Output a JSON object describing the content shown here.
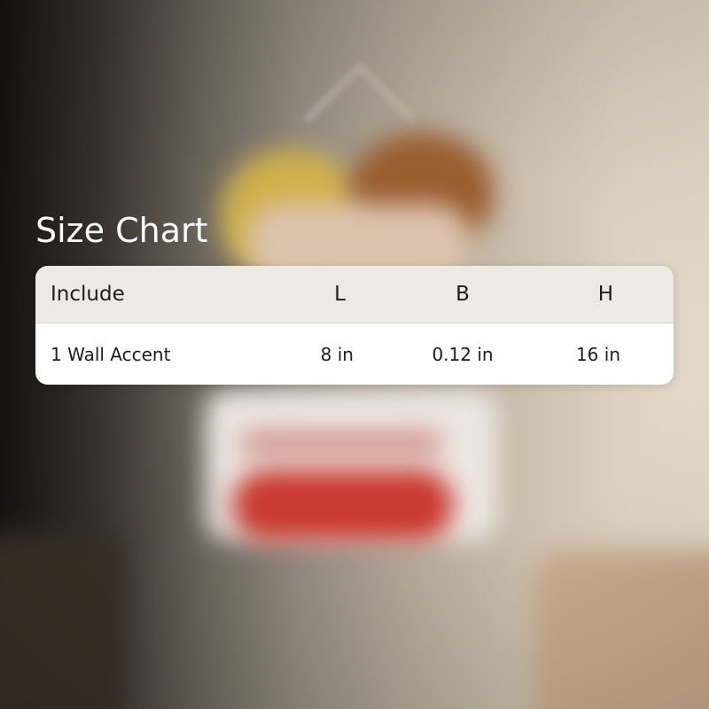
{
  "size_chart": {
    "title": "Size Chart",
    "columns": [
      "Include",
      "L",
      "B",
      "H"
    ],
    "rows": [
      [
        "1 Wall Accent",
        "8 in",
        "0.12 in",
        "16 in"
      ]
    ]
  },
  "colors": {
    "header_bg": "#edeae5",
    "body_bg": "#ffffff",
    "title_text": "#ffffff",
    "table_text": "#1d1d1d"
  }
}
